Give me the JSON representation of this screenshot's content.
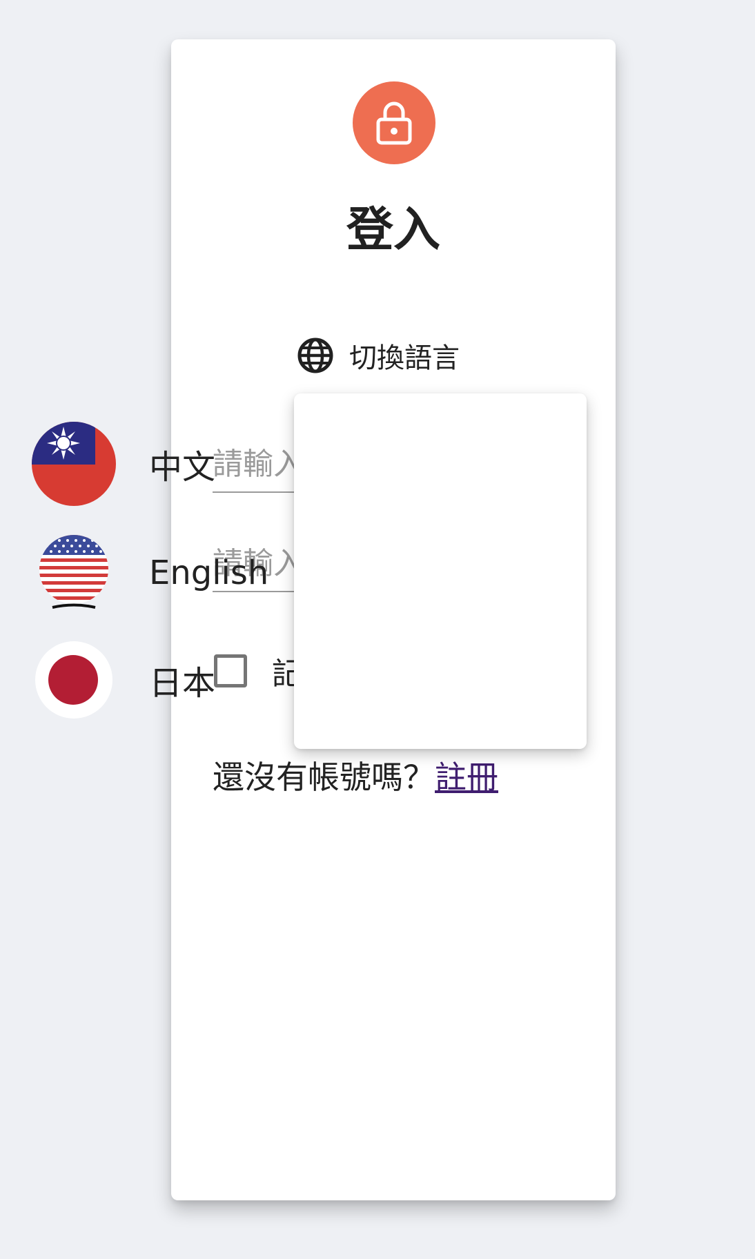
{
  "colors": {
    "background": "#eef0f4",
    "card": "#ffffff",
    "avatar": "#ee6e51",
    "link": "#3f1d6f"
  },
  "header": {
    "icon": "lock-icon",
    "title": "登入"
  },
  "language_switch": {
    "icon": "globe-icon",
    "label": "切換語言"
  },
  "form": {
    "field_1_placeholder": "請輸入",
    "field_2_placeholder": "請輸入",
    "remember_label_partial": "記",
    "remember_checked": false
  },
  "signup": {
    "prompt": "還沒有帳號嗎？",
    "link_label": "註冊"
  },
  "language_menu": {
    "items": [
      {
        "label": "中文",
        "icon": "taiwan-flag-icon"
      },
      {
        "label": "English",
        "icon": "usa-flag-icon"
      },
      {
        "label": "日本",
        "icon": "japan-flag-icon"
      }
    ]
  }
}
